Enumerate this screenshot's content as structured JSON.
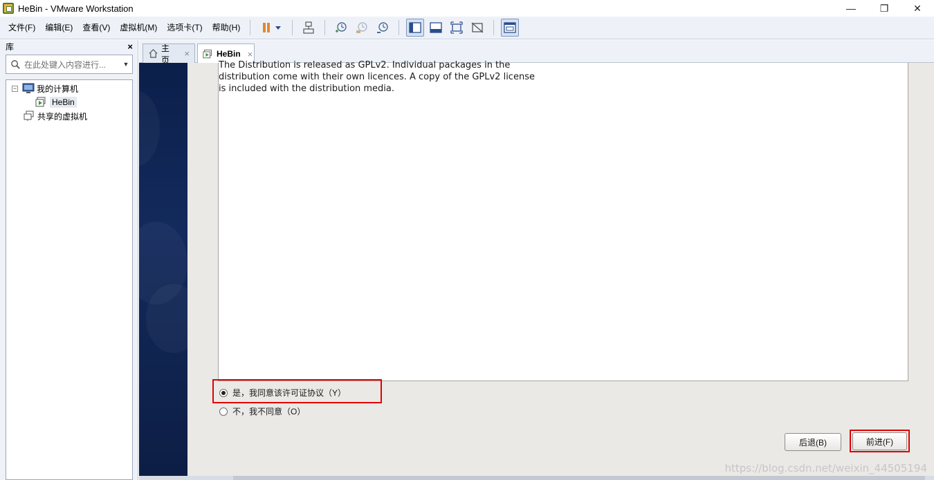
{
  "window": {
    "title": "HeBin - VMware Workstation",
    "minimize_icon": "minimize-icon",
    "restore_icon": "restore-icon",
    "close_icon": "close-icon",
    "minimize": "—",
    "restore": "❐",
    "close": "✕"
  },
  "menu": {
    "items": [
      "文件(F)",
      "编辑(E)",
      "查看(V)",
      "虚拟机(M)",
      "选项卡(T)",
      "帮助(H)"
    ]
  },
  "library": {
    "title": "库",
    "close": "×",
    "search_placeholder": "在此处键入内容进行...",
    "tree": {
      "my_computer": "我的计算机",
      "vm": "HeBin",
      "shared": "共享的虚拟机",
      "toggle": "−"
    }
  },
  "tabs": [
    {
      "label": "主页",
      "close": "×"
    },
    {
      "label": "HeBin",
      "close": "×"
    }
  ],
  "installer": {
    "license_lines": [
      "The Distribution is released as GPLv2. Individual packages in the",
      "distribution come with their own licences. A copy of the GPLv2 license",
      "is included with the distribution media."
    ],
    "agree_label": "是，我同意该许可证协议（Y）",
    "disagree_label": "不，我不同意（O）",
    "agree_selected": true,
    "back_button": "后退(B)",
    "forward_button": "前进(F)"
  },
  "watermark": "https://blog.csdn.net/weixin_44505194",
  "colors": {
    "highlight": "#e00000",
    "sidebar_dark": "#0b1f4a"
  }
}
